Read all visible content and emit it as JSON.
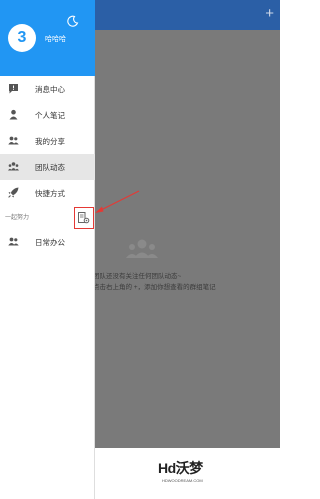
{
  "header": {
    "avatar_text": "3",
    "username": "哈哈哈",
    "moon_icon": "moon-icon",
    "color": "#2196f3"
  },
  "menu": [
    {
      "label": "消息中心",
      "icon": "message-icon"
    },
    {
      "label": "个人笔记",
      "icon": "person-icon"
    },
    {
      "label": "我的分享",
      "icon": "share-people-icon"
    },
    {
      "label": "团队动态",
      "icon": "team-icon",
      "active": true
    },
    {
      "label": "快捷方式",
      "icon": "rocket-icon"
    }
  ],
  "section": {
    "label": "一起努力",
    "settings_icon": "team-settings-icon",
    "items": [
      {
        "label": "日常办公",
        "icon": "group-icon"
      }
    ]
  },
  "main": {
    "add_icon": "+",
    "empty_line1": "团队还没有关注任何团队动态~",
    "empty_line2": "点击右上角的 +，添加你想查看的群组笔记"
  },
  "watermark": {
    "logo": "Hd沃梦",
    "url": "HDWOODREAM.COM"
  },
  "colors": {
    "app_bar": "#2b5fa6",
    "overlay": "#7a7a7a",
    "highlight_box": "#e53935"
  }
}
